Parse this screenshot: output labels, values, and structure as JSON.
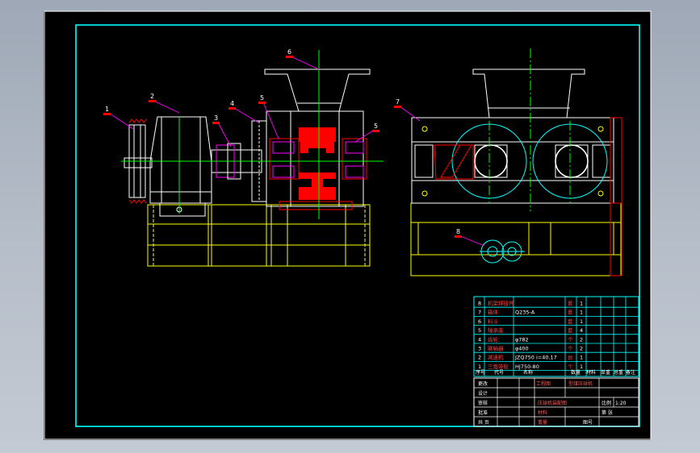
{
  "drawing": {
    "part_labels": [
      {
        "num": "1"
      },
      {
        "num": "2"
      },
      {
        "num": "3"
      },
      {
        "num": "4"
      },
      {
        "num": "5"
      },
      {
        "num": "5"
      },
      {
        "num": "6"
      },
      {
        "num": "7"
      },
      {
        "num": "8"
      }
    ]
  },
  "parts_list": {
    "rows": [
      {
        "no": "8",
        "name": "机架焊接件",
        "spec": "",
        "unit": "套",
        "qty": "1"
      },
      {
        "no": "7",
        "name": "箱体",
        "spec": "Q235-A",
        "unit": "套",
        "qty": "1"
      },
      {
        "no": "6",
        "name": "料斗",
        "spec": "",
        "unit": "套",
        "qty": "1"
      },
      {
        "no": "5",
        "name": "轴承座",
        "spec": "",
        "unit": "套",
        "qty": "4"
      },
      {
        "no": "4",
        "name": "齿轮",
        "spec": "φ782",
        "unit": "个",
        "qty": "2"
      },
      {
        "no": "3",
        "name": "联轴器",
        "spec": "φ400",
        "unit": "个",
        "qty": "2"
      },
      {
        "no": "2",
        "name": "减速机",
        "spec": "JZQ750 i=40.17",
        "unit": "台",
        "qty": "1"
      },
      {
        "no": "1",
        "name": "三角带轮",
        "spec": "HJ750-80",
        "unit": "个",
        "qty": "1"
      }
    ],
    "header": {
      "no": "序号",
      "code": "代号",
      "name": "名称",
      "qty": "数量",
      "material": "材料",
      "unit_weight": "单重",
      "total_weight": "总重",
      "remarks": "备注"
    }
  },
  "title_block": {
    "left_labels": [
      "更改",
      "设计",
      "审核",
      "批准",
      "共 页"
    ],
    "top_label": "工程图",
    "project": "型煤压球机",
    "drawing_name": "压球机装配图",
    "scale_label": "比例",
    "scale_value": "1:20",
    "sheet_label": "第 张",
    "material_label": "材料",
    "weight_label": "重量",
    "drawing_no_label": "图号"
  }
}
